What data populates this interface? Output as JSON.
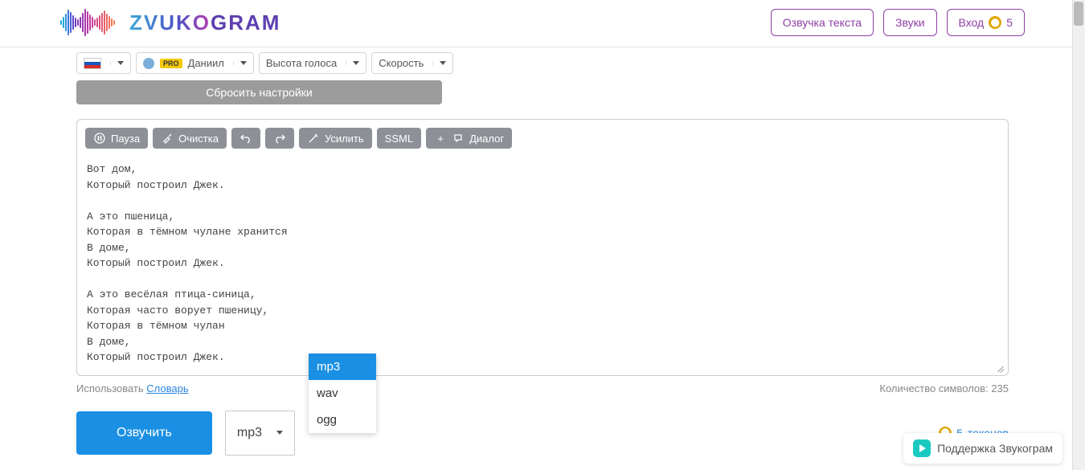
{
  "header": {
    "logo_left": "ZVUKO",
    "logo_right": "GRAM",
    "btn_voice": "Озвучка текста",
    "btn_sounds": "Звуки",
    "btn_login": "Вход",
    "credits": "5"
  },
  "selectors": {
    "voice_name": "Даниил",
    "pitch": "Высота голоса",
    "speed": "Скорость",
    "reset": "Сбросить настройки"
  },
  "toolbar": {
    "pause": "Пауза",
    "clean": "Очистка",
    "enhance": "Усилить",
    "ssml": "SSML",
    "dialog": "Диалог"
  },
  "text": "Вот дом,\nКоторый построил Джек.\n\nА это пшеница,\nКоторая в тёмном чулане хранится\nВ доме,\nКоторый построил Джек.\n\nА это весёлая птица-синица,\nКоторая часто ворует пшеницу,\nКоторая в тёмном чулан\nВ доме,\nКоторый построил Джек.",
  "under": {
    "use_label": "Использовать ",
    "dict_link": "Словарь",
    "char_count_label": "Количество символов: ",
    "char_count": "235"
  },
  "bottom": {
    "voice_btn": "Озвучить",
    "format_selected": "mp3",
    "tokens_count": "5",
    "tokens_label": "токенов"
  },
  "format_options": [
    "mp3",
    "wav",
    "ogg"
  ],
  "support": "Поддержка Звукограм"
}
